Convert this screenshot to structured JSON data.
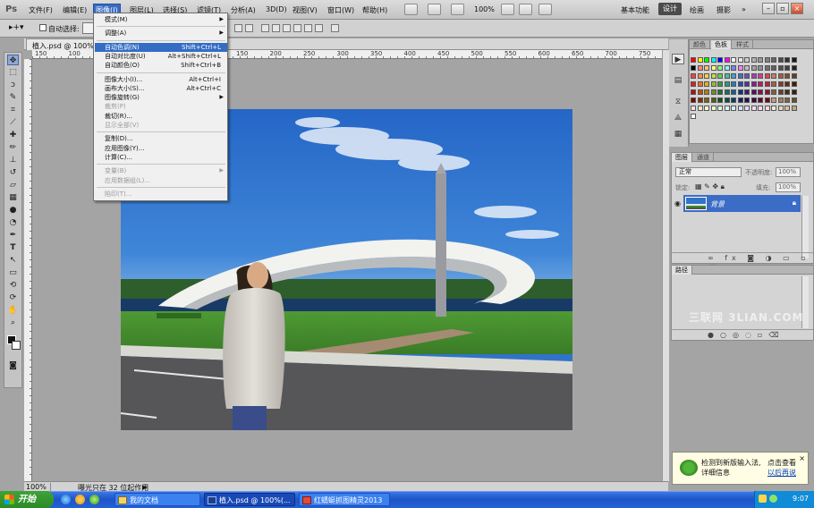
{
  "app": {
    "logo": "Ps"
  },
  "menubar": {
    "items": [
      "文件(F)",
      "编辑(E)",
      "图像(I)",
      "图层(L)",
      "选择(S)",
      "滤镜(T)",
      "分析(A)",
      "3D(D)",
      "视图(V)",
      "窗口(W)",
      "帮助(H)"
    ],
    "active_index": 2,
    "zoom": "100%",
    "workspaces": [
      "基本功能",
      "设计",
      "绘画",
      "摄影"
    ],
    "active_workspace": "设计",
    "more": "»"
  },
  "optionsbar": {
    "auto_select_label": "自动选择:"
  },
  "document": {
    "tab_title": "植入.psd @ 100%(RG...",
    "zoom": "100%",
    "status": "曝光只在 32 位起作用"
  },
  "ruler": {
    "h_labels": [
      "150",
      "100",
      "50",
      "0",
      "50",
      "100",
      "150",
      "200",
      "250",
      "300",
      "350",
      "400",
      "450",
      "500",
      "550",
      "600",
      "650",
      "700",
      "750"
    ]
  },
  "image_menu": {
    "rows": [
      {
        "label": "模式(M)",
        "submenu": true
      },
      {
        "sep": true
      },
      {
        "label": "调整(A)",
        "submenu": true
      },
      {
        "sep": true
      },
      {
        "label": "自动色调(N)",
        "shortcut": "Shift+Ctrl+L",
        "highlight": true
      },
      {
        "label": "自动对比度(U)",
        "shortcut": "Alt+Shift+Ctrl+L"
      },
      {
        "label": "自动颜色(O)",
        "shortcut": "Shift+Ctrl+B"
      },
      {
        "sep": true
      },
      {
        "label": "图像大小(I)...",
        "shortcut": "Alt+Ctrl+I"
      },
      {
        "label": "画布大小(S)...",
        "shortcut": "Alt+Ctrl+C"
      },
      {
        "label": "图像旋转(G)",
        "submenu": true
      },
      {
        "label": "裁剪(P)",
        "disabled": true
      },
      {
        "label": "裁切(R)..."
      },
      {
        "label": "显示全部(V)",
        "disabled": true
      },
      {
        "sep": true
      },
      {
        "label": "复制(D)..."
      },
      {
        "label": "应用图像(Y)..."
      },
      {
        "label": "计算(C)..."
      },
      {
        "sep": true
      },
      {
        "label": "变量(B)",
        "submenu": true,
        "disabled": true
      },
      {
        "label": "应用数据组(L)...",
        "disabled": true
      },
      {
        "sep": true
      },
      {
        "label": "陷印(T)...",
        "disabled": true
      }
    ]
  },
  "panels": {
    "color": {
      "tabs": [
        "颜色",
        "色板",
        "样式"
      ],
      "active": 1
    },
    "layers": {
      "tabs": [
        "图层",
        "通道"
      ],
      "active": 0,
      "blend_mode": "正常",
      "opacity_label": "不透明度:",
      "opacity": "100%",
      "lock_label": "锁定:",
      "fill_label": "填充:",
      "fill": "100%",
      "layer_name": "背景"
    },
    "paths": {
      "tabs": [
        "路径"
      ]
    }
  },
  "watermark": "三联网 3LIAN.COM",
  "notification": {
    "line1": "检测到新版输入法,",
    "line1b": "点击查看",
    "line2": "详细信息",
    "line2b": "以后再说",
    "close": "×"
  },
  "taskbar": {
    "start": "开始",
    "tasks": [
      {
        "label": "我的文档"
      },
      {
        "label": "植入.psd @ 100%(..."
      },
      {
        "label": "红蜻蜓抓图精灵2013"
      }
    ],
    "clock": "9:07"
  }
}
